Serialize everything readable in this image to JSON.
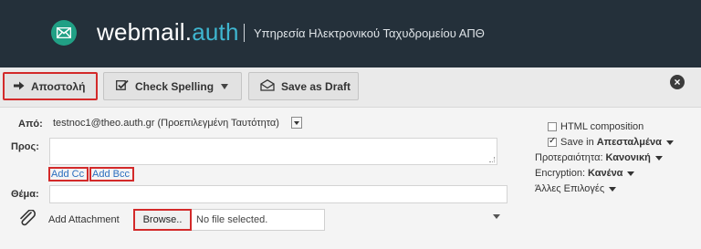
{
  "header": {
    "brand_main": "webmail.",
    "brand_suffix": "auth",
    "subtitle": "Υπηρεσία Ηλεκτρονικού Ταχυδρομείου ΑΠΘ"
  },
  "toolbar": {
    "send_label": "Αποστολή",
    "spell_label": "Check Spelling",
    "draft_label": "Save as Draft"
  },
  "form": {
    "from_label": "Από:",
    "from_value": "testnoc1@theo.auth.gr (Προεπιλεγμένη Ταυτότητα)",
    "to_label": "Προς:",
    "to_value": "",
    "add_cc": "Add Cc",
    "add_bcc": "Add Bcc",
    "subject_label": "Θέμα:",
    "subject_value": "",
    "attach_label": "Add Attachment",
    "browse_label": "Browse..",
    "no_file": "No file selected."
  },
  "options": {
    "html_composition": "HTML composition",
    "html_composition_checked": false,
    "save_in_prefix": "Save in",
    "save_in_folder": "Απεσταλμένα",
    "save_in_checked": true,
    "priority_label": "Προτεραιότητα:",
    "priority_value": "Κανονική",
    "encryption_label": "Encryption:",
    "encryption_value": "Κανένα",
    "other_options": "Άλλες Επιλογές"
  },
  "colors": {
    "header_bg": "#24303a",
    "brand_accent": "#3fb6d0",
    "logo_green": "#21a085",
    "highlight_red": "#d32a2a"
  }
}
